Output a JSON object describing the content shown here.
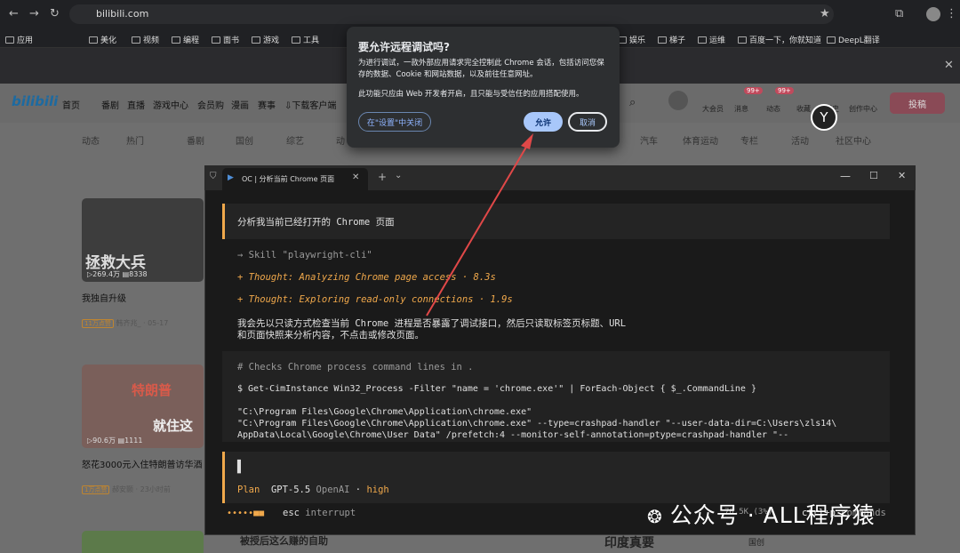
{
  "browser": {
    "url": "bilibili.com",
    "bookmarks": [
      "应用",
      "美化",
      "视频",
      "编程",
      "面书",
      "游戏",
      "工具",
      "娱乐",
      "梯子",
      "运维",
      "百度一下，你就知道",
      "DeepL翻译"
    ]
  },
  "bili": {
    "logo": "bilibili",
    "nav": [
      "首页",
      "番剧",
      "直播",
      "游戏中心",
      "会员购",
      "漫画",
      "赛事",
      "下载客户端"
    ],
    "right_nav": [
      "大会员",
      "消息",
      "动态",
      "收藏",
      "历史",
      "创作中心"
    ],
    "badge1": "99+",
    "badge2": "99+",
    "upload": "投稿",
    "categories": [
      "动态",
      "热门",
      "番剧",
      "国创",
      "综艺",
      "动",
      "汽车",
      "体育运动",
      "专栏",
      "活动",
      "社区中心"
    ],
    "card1": {
      "title": "我独自升级",
      "views": "269.4万",
      "danmaku": "8338",
      "tag": "11万点赞",
      "author": "韩齐兆_ · 05-17",
      "overlay": "拯救大兵"
    },
    "card2": {
      "title": "怒花3000元入住特朗普访华酒",
      "views": "90.6万",
      "danmaku": "1111",
      "tag": "1万点赞",
      "author": "郝安颢 · 23小时前",
      "overlay1": "特朗普",
      "overlay2": "就住这"
    },
    "bottom_thumb": "被授后这么赚的自助",
    "bottom_thumb2": "印度真要",
    "bottom_tag": "国创"
  },
  "dialog": {
    "title": "要允许远程调试吗?",
    "para1": "为进行调试，一款外部应用请求完全控制此 Chrome 会话，包括访问您保存的数据、Cookie 和网站数据，以及前往任意网址。",
    "para2": "此功能只应由 Web 开发者开启，且只能与受信任的应用搭配使用。",
    "settings_btn": "在\"设置\"中关闭",
    "allow_btn": "允许",
    "cancel_btn": "取消"
  },
  "terminal": {
    "tab_title": "OC | 分析当前 Chrome 页面",
    "prompt": "分析我当前已经打开的 Chrome 页面",
    "skill": "→ Skill \"playwright-cli\"",
    "thought1": "+ Thought: Analyzing Chrome page access · 8.3s",
    "thought2": "+ Thought: Exploring read-only connections · 1.9s",
    "reply1": "我会先以只读方式检查当前 Chrome 进程是否暴露了调试接口，然后只读取标签页标题、URL",
    "reply2": "和页面快照来分析内容，不点击或修改页面。",
    "comment": "# Checks Chrome process command lines in .",
    "command": "$ Get-CimInstance Win32_Process -Filter \"name = 'chrome.exe'\" | ForEach-Object { $_.CommandLine }",
    "out1": "\"C:\\Program Files\\Google\\Chrome\\Application\\chrome.exe\"",
    "out2": "\"C:\\Program Files\\Google\\Chrome\\Application\\chrome.exe\" --type=crashpad-handler \"--user-data-dir=C:\\Users\\zls14\\",
    "out3": "AppData\\Local\\Google\\Chrome\\User Data\" /prefetch:4 --monitor-self-annotation=ptype=crashpad-handler \"--",
    "cursor": "▌",
    "mode": "Plan",
    "model": "GPT-5.5",
    "provider": "OpenAI",
    "effort": "high",
    "esc": "esc",
    "interrupt": "interrupt",
    "ctx": "70.5K (3%)",
    "shortcut": "ctrl+p",
    "commands": "commands"
  },
  "watermark": "公众号 · ALL程序猿"
}
